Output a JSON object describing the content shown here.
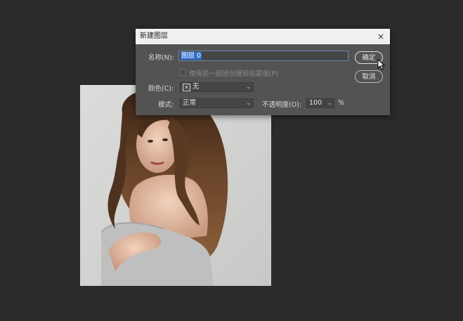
{
  "dialog": {
    "title": "新建图层",
    "close_glyph": "×",
    "name_label": "名称(N):",
    "name_value": "图层 0",
    "clip_label": "使用前一图层创建剪贴蒙版(P)",
    "color_label": "颜色(C):",
    "color_value": "无",
    "color_swatch_glyph": "✕",
    "mode_label": "模式:",
    "mode_value": "正常",
    "opacity_label": "不透明度(O):",
    "opacity_value": "100",
    "opacity_unit": "%",
    "ok_label": "确定",
    "cancel_label": "取消",
    "dropdown_glyph": "⌄"
  },
  "icons": {
    "cursor": "arrow-cursor-icon",
    "close": "close-icon"
  },
  "colors": {
    "workspace": "#2b2b2b",
    "dialog_bg": "#535353",
    "titlebar": "#f0f0f0",
    "selection": "#2f6fd0"
  }
}
